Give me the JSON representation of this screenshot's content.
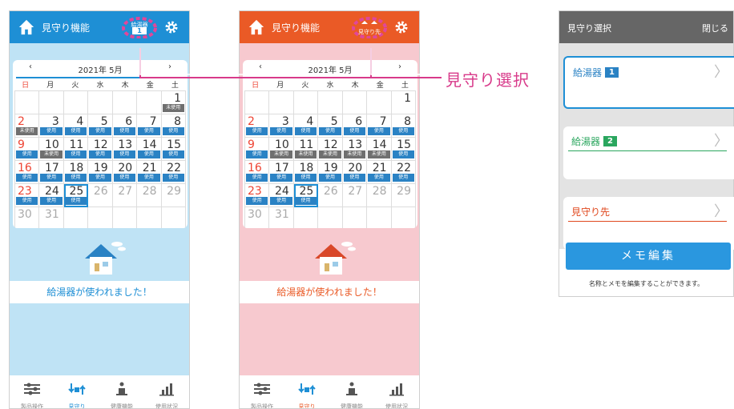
{
  "phones": [
    {
      "title": "見守り機能",
      "selector_label": "給湯器",
      "selector_num": "1",
      "month_label": "2021年  5月",
      "weekdays": [
        "日",
        "月",
        "火",
        "水",
        "木",
        "金",
        "土"
      ],
      "message": "給湯器が使われました！",
      "colors": {
        "accent": "#1e8fd5",
        "background": "#bfe3f5"
      }
    },
    {
      "title": "見守り機能",
      "selector_label": "見守り先",
      "selector_num": "",
      "month_label": "2021年  5月",
      "weekdays": [
        "日",
        "月",
        "火",
        "水",
        "木",
        "金",
        "土"
      ],
      "message": "給湯器が使われました！",
      "colors": {
        "accent": "#ea5a26",
        "background": "#f7c9cf"
      }
    }
  ],
  "calendar": {
    "nav_prev": "‹",
    "nav_next": "›",
    "days": [
      {
        "d": "",
        "b": ""
      },
      {
        "d": "",
        "b": ""
      },
      {
        "d": "",
        "b": ""
      },
      {
        "d": "",
        "b": ""
      },
      {
        "d": "",
        "b": ""
      },
      {
        "d": "",
        "b": ""
      },
      {
        "d": "1",
        "b": "未使用"
      },
      {
        "d": "2",
        "b": "未使用"
      },
      {
        "d": "3",
        "b": "使用"
      },
      {
        "d": "4",
        "b": "使用"
      },
      {
        "d": "5",
        "b": "使用"
      },
      {
        "d": "6",
        "b": "使用"
      },
      {
        "d": "7",
        "b": "使用"
      },
      {
        "d": "8",
        "b": "使用"
      },
      {
        "d": "9",
        "b": "使用"
      },
      {
        "d": "10",
        "b": "未使用"
      },
      {
        "d": "11",
        "b": "使用"
      },
      {
        "d": "12",
        "b": "使用"
      },
      {
        "d": "13",
        "b": "使用"
      },
      {
        "d": "14",
        "b": "使用"
      },
      {
        "d": "15",
        "b": "使用"
      },
      {
        "d": "16",
        "b": "使用"
      },
      {
        "d": "17",
        "b": "使用"
      },
      {
        "d": "18",
        "b": "使用"
      },
      {
        "d": "19",
        "b": "使用"
      },
      {
        "d": "20",
        "b": "使用"
      },
      {
        "d": "21",
        "b": "使用"
      },
      {
        "d": "22",
        "b": "使用"
      },
      {
        "d": "23",
        "b": "使用"
      },
      {
        "d": "24",
        "b": "使用"
      },
      {
        "d": "25",
        "b": "使用"
      },
      {
        "d": "26",
        "b": ""
      },
      {
        "d": "27",
        "b": ""
      },
      {
        "d": "28",
        "b": ""
      },
      {
        "d": "29",
        "b": ""
      },
      {
        "d": "30",
        "b": ""
      },
      {
        "d": "31",
        "b": ""
      },
      {
        "d": "",
        "b": ""
      },
      {
        "d": "",
        "b": ""
      },
      {
        "d": "",
        "b": ""
      },
      {
        "d": "",
        "b": ""
      },
      {
        "d": "",
        "b": ""
      }
    ],
    "phone2_badges": [
      "",
      "",
      "",
      "",
      "",
      "",
      "",
      "使用",
      "使用",
      "使用",
      "使用",
      "使用",
      "使用",
      "使用",
      "使用",
      "未使用",
      "未使用",
      "未使用",
      "未使用",
      "未使用",
      "使用",
      "使用",
      "使用",
      "使用",
      "使用",
      "使用",
      "使用",
      "使用",
      "使用",
      "使用",
      "使用",
      "",
      "",
      "",
      "",
      "",
      "",
      "",
      "",
      "",
      "",
      ""
    ],
    "today": "25"
  },
  "bottom_nav": [
    {
      "label": "製品操作",
      "icon": "sliders-icon"
    },
    {
      "label": "見守り",
      "icon": "watch-exchange-icon"
    },
    {
      "label": "健康機能",
      "icon": "person-scale-icon"
    },
    {
      "label": "使用状況",
      "icon": "bar-chart-icon"
    }
  ],
  "callout": {
    "text": "見守り選択",
    "color": "#d83a8a"
  },
  "panel": {
    "title": "見守り選択",
    "close_label": "閉じる",
    "options": [
      {
        "label": "給湯器",
        "num": "1"
      },
      {
        "label": "給湯器",
        "num": "2"
      },
      {
        "label": "見守り先",
        "num": ""
      }
    ],
    "memo_button": "メモ編集",
    "memo_note": "名称とメモを編集することができます。"
  }
}
